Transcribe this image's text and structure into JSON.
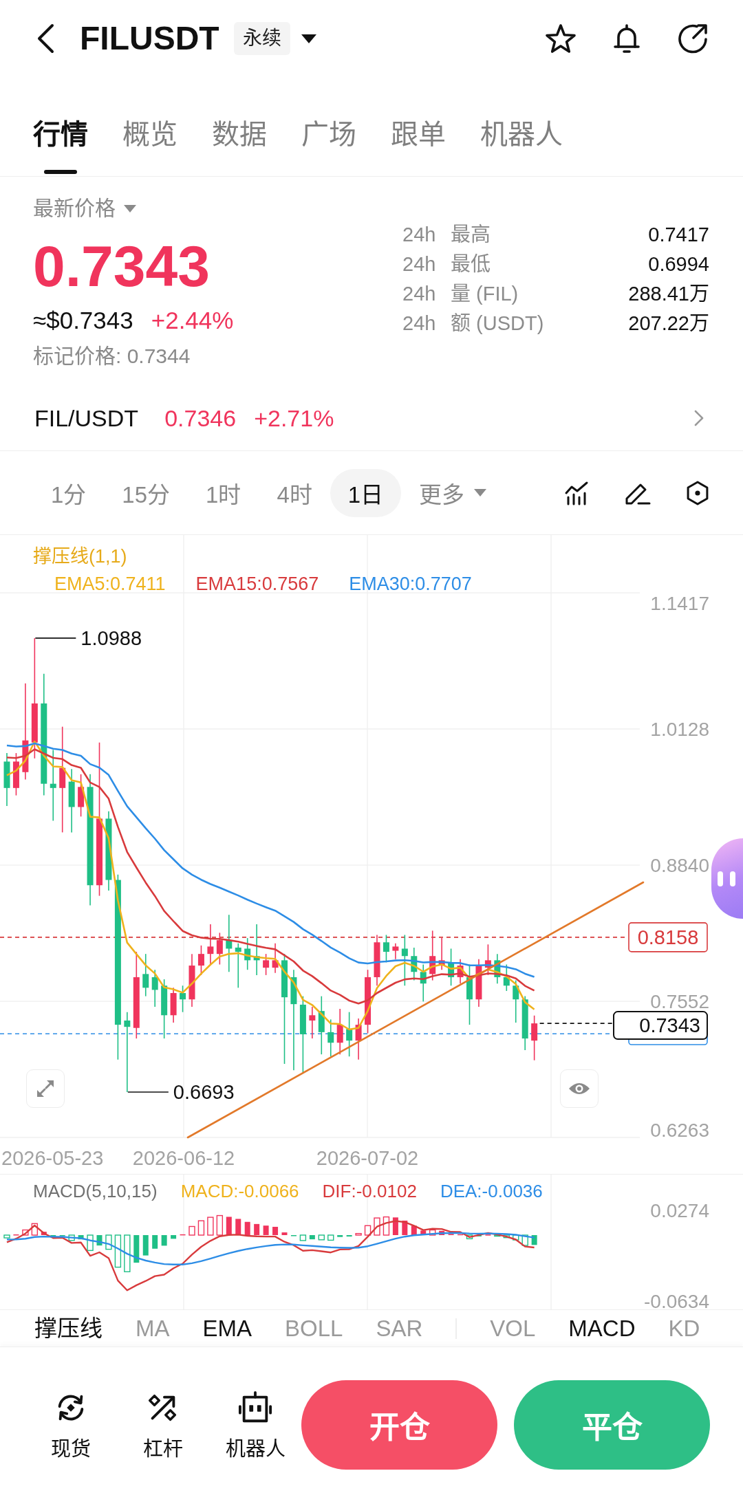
{
  "header": {
    "title": "FILUSDT",
    "badge": "永续"
  },
  "tabs": [
    {
      "label": "行情",
      "selected": true
    },
    {
      "label": "概览",
      "selected": false
    },
    {
      "label": "数据",
      "selected": false
    },
    {
      "label": "广场",
      "selected": false
    },
    {
      "label": "跟单",
      "selected": false
    },
    {
      "label": "机器人",
      "selected": false
    }
  ],
  "price_panel": {
    "price_type": "最新价格",
    "last_price": "0.7343",
    "usd_price": "≈$0.7343",
    "change": "+2.44%",
    "mark_price": "标记价格: 0.7344",
    "stats": [
      {
        "period": "24h",
        "label": "最高",
        "value": "0.7417"
      },
      {
        "period": "24h",
        "label": "最低",
        "value": "0.6994"
      },
      {
        "period": "24h",
        "label": "量 (FIL)",
        "value": "288.41万"
      },
      {
        "period": "24h",
        "label": "额 (USDT)",
        "value": "207.22万"
      }
    ]
  },
  "spot_pair": {
    "pair": "FIL/USDT",
    "price": "0.7346",
    "change": "+2.71%"
  },
  "intervals": [
    {
      "label": "1分",
      "kind": "interval",
      "selected": false
    },
    {
      "label": "15分",
      "kind": "interval",
      "selected": false
    },
    {
      "label": "1时",
      "kind": "interval",
      "selected": false
    },
    {
      "label": "4时",
      "kind": "interval",
      "selected": false
    },
    {
      "label": "1日",
      "kind": "interval",
      "selected": true
    },
    {
      "label": "更多",
      "kind": "dropdown",
      "selected": false
    }
  ],
  "chart": {
    "overlay": "撑压线(1,1)",
    "legend": [
      {
        "label": "EMA5:0.7411",
        "color": "#efb21c"
      },
      {
        "label": "EMA15:0.7567",
        "color": "#d83a3c"
      },
      {
        "label": "EMA30:0.7707",
        "color": "#2d8de6"
      }
    ],
    "price_ticks": [
      "1.1417",
      "1.0128",
      "0.8840",
      "0.7552",
      "0.6263"
    ],
    "high_label": "1.0988",
    "low_label": "0.6693",
    "resistance_tag": "0.8158",
    "last_price_tag": "0.7343",
    "dates": [
      "2026-05-23",
      "2026-06-12",
      "2026-07-02"
    ]
  },
  "macd": {
    "title": "MACD(5,10,15)",
    "legend": [
      {
        "label": "MACD:-0.0066",
        "color": "#efb21c"
      },
      {
        "label": "DIF:-0.0102",
        "color": "#d83a3c"
      },
      {
        "label": "DEA:-0.0036",
        "color": "#2d8de6"
      }
    ],
    "ticks": [
      "0.0274",
      "-0.0634"
    ]
  },
  "indicators": {
    "main": [
      {
        "label": "撑压线",
        "selected": true
      },
      {
        "label": "MA",
        "selected": false
      },
      {
        "label": "EMA",
        "selected": true
      },
      {
        "label": "BOLL",
        "selected": false
      },
      {
        "label": "SAR",
        "selected": false
      }
    ],
    "sub": [
      {
        "label": "VOL",
        "selected": false
      },
      {
        "label": "MACD",
        "selected": true
      },
      {
        "label": "KD",
        "selected": false
      }
    ]
  },
  "bottom_nav": [
    {
      "label": "现货",
      "kind": "spot"
    },
    {
      "label": "杠杆",
      "kind": "margin"
    },
    {
      "label": "机器人",
      "kind": "robot"
    }
  ],
  "actions": [
    {
      "label": "开仓",
      "kind": "open"
    },
    {
      "label": "平仓",
      "kind": "close"
    }
  ]
}
